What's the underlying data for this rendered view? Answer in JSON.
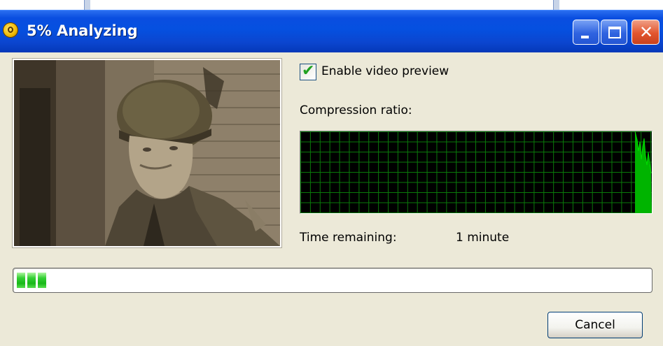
{
  "window": {
    "title": "5% Analyzing",
    "icons": {
      "app": "app-disc-icon",
      "minimize": "minimize-icon",
      "maximize": "maximize-icon",
      "close": "close-icon"
    }
  },
  "preview": {
    "enable_label": "Enable video preview",
    "enabled": true,
    "image": "video-frame-soldier"
  },
  "compression": {
    "label": "Compression ratio:",
    "grid_color": "#0a7a0a",
    "line_color": "#00d000"
  },
  "time_remaining": {
    "label": "Time remaining:",
    "value": "1 minute"
  },
  "progress": {
    "percent": 5,
    "fill_color": "#18b818"
  },
  "buttons": {
    "cancel": "Cancel"
  },
  "colors": {
    "title_bar": "#0550e0",
    "dialog_bg": "#ece9d8",
    "close_button": "#e2552e"
  }
}
